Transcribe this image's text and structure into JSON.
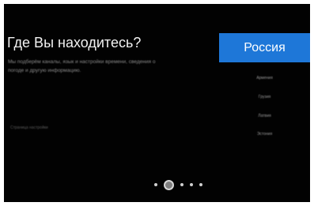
{
  "screen": {
    "question": "Где Вы находитесь?",
    "description": "Мы подберём каналы, язык и настройки времени, сведения о погоде и другую информацию."
  },
  "setup": {
    "step_label": "Страница настройки"
  },
  "countries": {
    "selected": "Россия",
    "others": [
      "Армения",
      "Грузия",
      "Латвия",
      "Эстония"
    ]
  },
  "pager": {
    "total": 5,
    "active": 2
  },
  "colors": {
    "background": "#020202",
    "accent": "#1e77d8"
  }
}
